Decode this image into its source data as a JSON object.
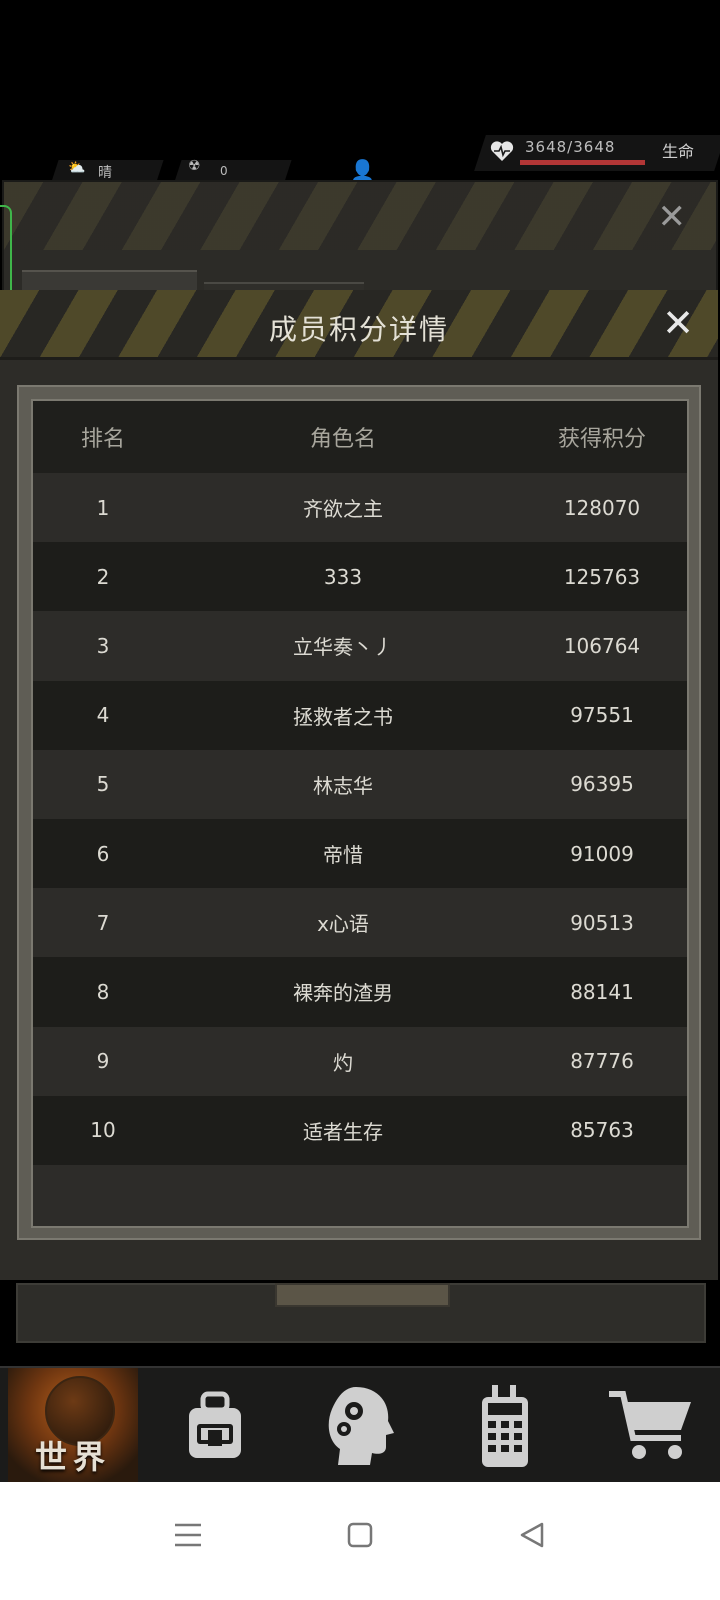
{
  "hud": {
    "weather_label": "晴",
    "radiation_value": "0",
    "life_value": "3648/3648",
    "life_fraction": 1.0,
    "life_label": "生命"
  },
  "modal": {
    "title": "成员积分详情",
    "close_icon": "close-icon",
    "columns": [
      "排名",
      "角色名",
      "获得积分"
    ],
    "rows": [
      {
        "rank": "1",
        "name": "齐欲之主",
        "score": "128070"
      },
      {
        "rank": "2",
        "name": "333",
        "score": "125763"
      },
      {
        "rank": "3",
        "name": "立华奏丶丿",
        "score": "106764"
      },
      {
        "rank": "4",
        "name": "拯救者之书",
        "score": "97551"
      },
      {
        "rank": "5",
        "name": "林志华",
        "score": "96395"
      },
      {
        "rank": "6",
        "name": "帝惜",
        "score": "91009"
      },
      {
        "rank": "7",
        "name": "x心语",
        "score": "90513"
      },
      {
        "rank": "8",
        "name": "裸奔的渣男",
        "score": "88141"
      },
      {
        "rank": "9",
        "name": "灼",
        "score": "87776"
      },
      {
        "rank": "10",
        "name": "适者生存",
        "score": "85763"
      }
    ]
  },
  "game_nav": {
    "items": [
      {
        "label": "世界",
        "icon": "globe-icon"
      },
      {
        "label": "",
        "icon": "backpack-icon"
      },
      {
        "label": "",
        "icon": "head-gears-icon"
      },
      {
        "label": "",
        "icon": "radio-icon"
      },
      {
        "label": "",
        "icon": "cart-icon"
      }
    ]
  },
  "system_nav": {
    "icons": [
      "menu-icon",
      "home-icon",
      "back-icon"
    ]
  },
  "colors": {
    "stripe_yellow": "#6b6132",
    "panel": "#2d2c28",
    "life_bar": "#b23636",
    "green_edge": "#3fb64a"
  }
}
